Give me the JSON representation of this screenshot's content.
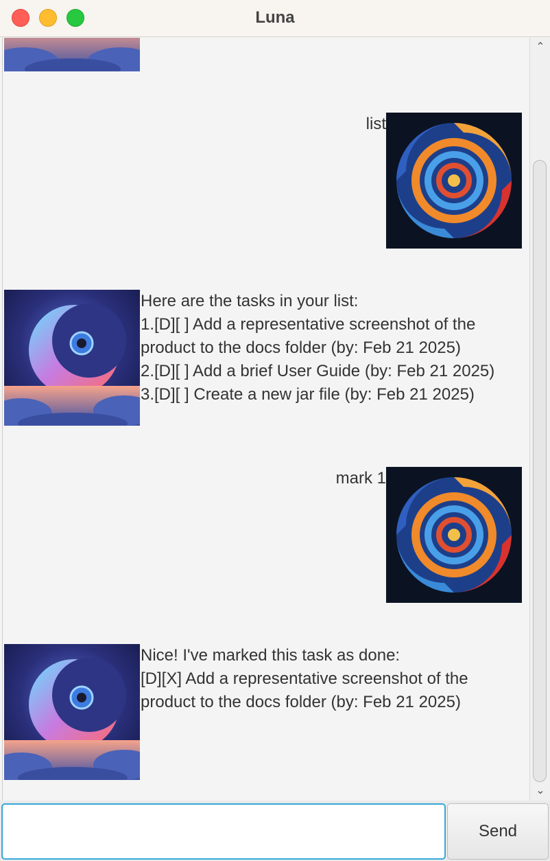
{
  "window": {
    "title": "Luna"
  },
  "messages": [
    {
      "sender": "user",
      "text": "list"
    },
    {
      "sender": "luna",
      "text": "Here are the tasks in your list:\n1.[D][ ] Add a representative screenshot of the\nproduct to the docs folder (by: Feb 21 2025)\n2.[D][ ] Add a brief User Guide (by: Feb 21 2025)\n3.[D][ ] Create a new jar file (by: Feb 21 2025)"
    },
    {
      "sender": "user",
      "text": "mark 1"
    },
    {
      "sender": "luna",
      "text": "Nice! I've marked this task as done:\n[D][X] Add a representative screenshot of the\nproduct to the docs folder (by: Feb 21 2025)"
    }
  ],
  "input": {
    "value": "",
    "placeholder": ""
  },
  "send_button": {
    "label": "Send"
  },
  "icons": {
    "luna_avatar": "crescent-moon-icon",
    "user_avatar": "swirl-icon",
    "scroll_up": "chevron-up-icon",
    "scroll_down": "chevron-down-icon"
  },
  "colors": {
    "input_focus": "#36a7d8",
    "background": "#f4f4f4"
  }
}
